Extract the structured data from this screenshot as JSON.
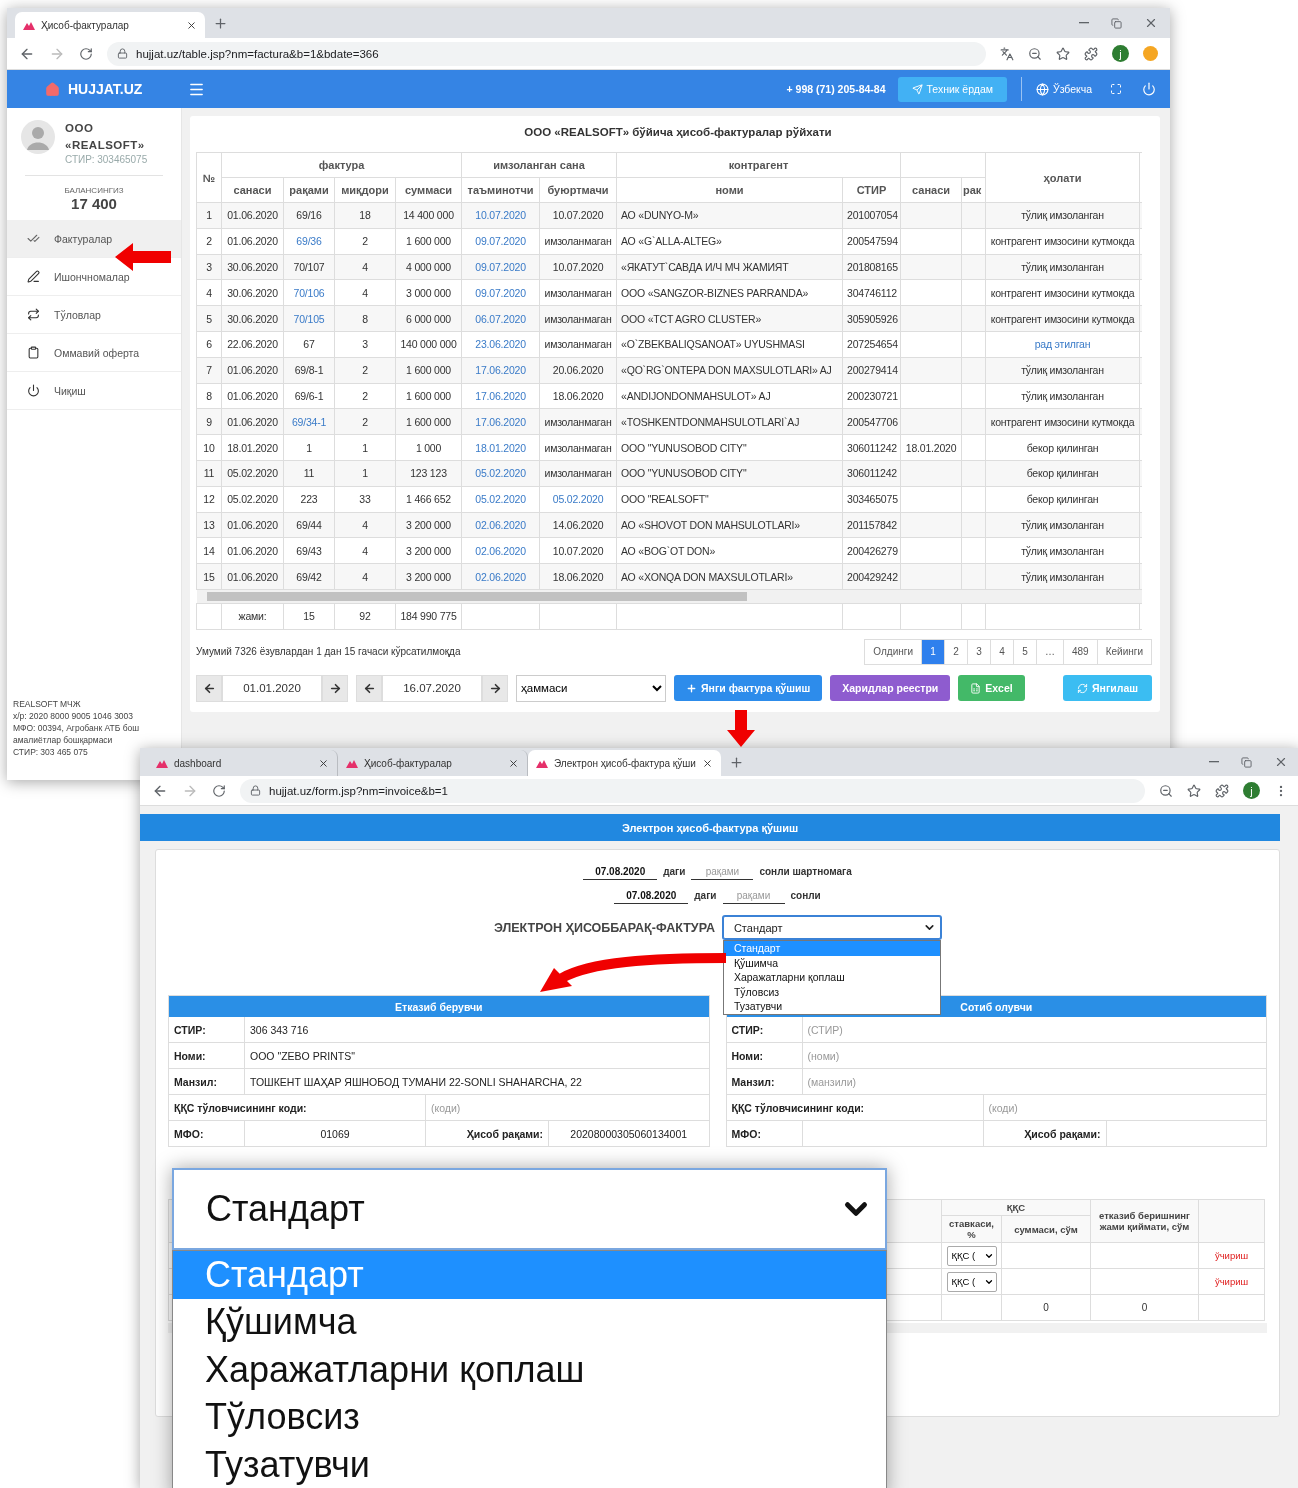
{
  "window1": {
    "tab_title": "Ҳисоб-фактуралар",
    "url": "hujjat.uz/table.jsp?nm=factura&b=1&bdate=366",
    "profile_initial": "j",
    "navbar": {
      "brand": "HUJJAT.UZ",
      "phone": "+ 998 (71) 205-84-84",
      "help_button": "Техник ёрдам",
      "language": "Ўзбекча"
    },
    "sidebar": {
      "company": "ООО «REALSOFT»",
      "stir": "СТИР: 303465075",
      "balance_label": "БАЛАНСИНГИЗ",
      "balance": "17 400",
      "items": [
        {
          "label": "Фактуралар",
          "kind": "invoices",
          "selected": true
        },
        {
          "label": "Ишончномалар",
          "kind": "proxies",
          "selected": false
        },
        {
          "label": "Тўловлар",
          "kind": "payments",
          "selected": false
        },
        {
          "label": "Оммавий оферта",
          "kind": "offer",
          "selected": false
        },
        {
          "label": "Чиқиш",
          "kind": "logout",
          "selected": false
        }
      ],
      "footer": [
        "REALSOFT МЧЖ",
        "х/р: 2020 8000 9005 1046 3003",
        "МФО: 00394, Агробанк АТБ бош амалиётлар бошқармаси",
        "СТИР: 303 465 075"
      ]
    },
    "table": {
      "title": "ООО «REALSOFT» бўйича ҳисоб-фактуралар рўйхати",
      "group_headers": [
        "фактура",
        "имзоланган сана",
        "контрагент"
      ],
      "columns": [
        "№",
        "санаси",
        "рақами",
        "миқдори",
        "суммаси",
        "таъминотчи",
        "буюртмачи",
        "номи",
        "СТИР",
        "санаси",
        "рак",
        "ҳолати"
      ],
      "rows": [
        {
          "no": "1",
          "date": "01.06.2020",
          "number": "69/16",
          "number_link": false,
          "qty": "18",
          "sum": "14 400 000",
          "supplier_date": "10.07.2020",
          "buyer_date": "10.07.2020",
          "buyer_link": false,
          "name": "АО «DUNYO-M»",
          "stir": "201007054",
          "status": "тўлиқ имзоланган",
          "status_link": false
        },
        {
          "no": "2",
          "date": "01.06.2020",
          "number": "69/36",
          "number_link": true,
          "qty": "2",
          "sum": "1 600 000",
          "supplier_date": "09.07.2020",
          "buyer_date": "имзоланмаган",
          "buyer_link": false,
          "name": "АО «G`ALLA-ALTEG»",
          "stir": "200547594",
          "status": "контрагент имзосини кутмокда",
          "status_link": false
        },
        {
          "no": "3",
          "date": "30.06.2020",
          "number": "70/107",
          "number_link": false,
          "qty": "4",
          "sum": "4 000 000",
          "supplier_date": "09.07.2020",
          "buyer_date": "10.07.2020",
          "buyer_link": false,
          "name": "«ЯКАТУТ`САВДА И/Ч МЧ ЖАМИЯТ",
          "stir": "201808165",
          "status": "тўлиқ имзоланган",
          "status_link": false
        },
        {
          "no": "4",
          "date": "30.06.2020",
          "number": "70/106",
          "number_link": true,
          "qty": "4",
          "sum": "3 000 000",
          "supplier_date": "09.07.2020",
          "buyer_date": "имзоланмаган",
          "buyer_link": false,
          "name": "ООО «SANGZOR-BIZNES PARRANDA»",
          "stir": "304746112",
          "status": "контрагент имзосини кутмокда",
          "status_link": false
        },
        {
          "no": "5",
          "date": "30.06.2020",
          "number": "70/105",
          "number_link": true,
          "qty": "8",
          "sum": "6 000 000",
          "supplier_date": "06.07.2020",
          "buyer_date": "имзоланмаган",
          "buyer_link": false,
          "name": "ООО «TCT AGRO CLUSTER»",
          "stir": "305905926",
          "status": "контрагент имзосини кутмокда",
          "status_link": false
        },
        {
          "no": "6",
          "date": "22.06.2020",
          "number": "67",
          "number_link": false,
          "qty": "3",
          "sum": "140 000 000",
          "supplier_date": "23.06.2020",
          "buyer_date": "имзоланмаган",
          "buyer_link": false,
          "name": "«O`ZBEKBALIQSANOAT» UYUSHMASI",
          "stir": "207254654",
          "status": "рад этилган",
          "status_link": true
        },
        {
          "no": "7",
          "date": "01.06.2020",
          "number": "69/8-1",
          "number_link": false,
          "qty": "2",
          "sum": "1 600 000",
          "supplier_date": "17.06.2020",
          "buyer_date": "20.06.2020",
          "buyer_link": false,
          "name": "«QO`RG`ONTEPA DON MAXSULOTLARI» AJ",
          "stir": "200279414",
          "status": "тўлиқ имзоланган",
          "status_link": false
        },
        {
          "no": "8",
          "date": "01.06.2020",
          "number": "69/6-1",
          "number_link": false,
          "qty": "2",
          "sum": "1 600 000",
          "supplier_date": "17.06.2020",
          "buyer_date": "18.06.2020",
          "buyer_link": false,
          "name": "«ANDIJONDONMAHSULOT» AJ",
          "stir": "200230721",
          "status": "тўлиқ имзоланган",
          "status_link": false
        },
        {
          "no": "9",
          "date": "01.06.2020",
          "number": "69/34-1",
          "number_link": true,
          "qty": "2",
          "sum": "1 600 000",
          "supplier_date": "17.06.2020",
          "buyer_date": "имзоланмаган",
          "buyer_link": false,
          "name": "«TOSHKENTDONMAHSULOTLARI`AJ",
          "stir": "200547706",
          "status": "контрагент имзосини кутмокда",
          "status_link": false
        },
        {
          "no": "10",
          "date": "18.01.2020",
          "number": "1",
          "number_link": false,
          "qty": "1",
          "sum": "1 000",
          "supplier_date": "18.01.2020",
          "buyer_date": "имзоланмаган",
          "buyer_link": false,
          "name": "ООО \"YUNUSOBOD CITY\"",
          "stir": "306011242",
          "cp_date": "18.01.2020",
          "status": "бекор қилинган",
          "status_link": false
        },
        {
          "no": "11",
          "date": "05.02.2020",
          "number": "11",
          "number_link": false,
          "qty": "1",
          "sum": "123 123",
          "supplier_date": "05.02.2020",
          "buyer_date": "имзоланмаган",
          "buyer_link": false,
          "name": "ООО \"YUNUSOBOD CITY\"",
          "stir": "306011242",
          "status": "бекор қилинган",
          "status_link": false
        },
        {
          "no": "12",
          "date": "05.02.2020",
          "number": "223",
          "number_link": false,
          "qty": "33",
          "sum": "1 466 652",
          "supplier_date": "05.02.2020",
          "buyer_date": "05.02.2020",
          "buyer_link": true,
          "name": "ООО \"REALSOFT\"",
          "stir": "303465075",
          "status": "бекор қилинган",
          "status_link": false
        },
        {
          "no": "13",
          "date": "01.06.2020",
          "number": "69/44",
          "number_link": false,
          "qty": "4",
          "sum": "3 200 000",
          "supplier_date": "02.06.2020",
          "buyer_date": "14.06.2020",
          "buyer_link": false,
          "name": "АО «SHOVOT DON MAHSULOTLARI»",
          "stir": "201157842",
          "status": "тўлиқ имзоланган",
          "status_link": false
        },
        {
          "no": "14",
          "date": "01.06.2020",
          "number": "69/43",
          "number_link": false,
          "qty": "4",
          "sum": "3 200 000",
          "supplier_date": "02.06.2020",
          "buyer_date": "10.07.2020",
          "buyer_link": false,
          "name": "АО «BOG`OT DON»",
          "stir": "200426279",
          "status": "тўлиқ имзоланган",
          "status_link": false
        },
        {
          "no": "15",
          "date": "01.06.2020",
          "number": "69/42",
          "number_link": false,
          "qty": "4",
          "sum": "3 200 000",
          "supplier_date": "02.06.2020",
          "buyer_date": "18.06.2020",
          "buyer_link": false,
          "name": "АО «XONQA DON MAXSULOTLARI»",
          "stir": "200429242",
          "status": "тўлиқ имзоланган",
          "status_link": false
        }
      ],
      "totals": {
        "label": "жами:",
        "count": "15",
        "quantity": "92",
        "sum": "184 990 775"
      }
    },
    "summary": "Умумий 7326 ёзувлардан 1 дан 15 гачаси кўрсатилмоқда",
    "pagination": [
      {
        "label": "Олдинги",
        "selected": false
      },
      {
        "label": "1",
        "selected": true
      },
      {
        "label": "2",
        "selected": false
      },
      {
        "label": "3",
        "selected": false
      },
      {
        "label": "4",
        "selected": false
      },
      {
        "label": "5",
        "selected": false
      },
      {
        "label": "…",
        "selected": false
      },
      {
        "label": "489",
        "selected": false
      },
      {
        "label": "Кейинги",
        "selected": false
      }
    ],
    "filters": {
      "date_from": "01.01.2020",
      "date_to": "16.07.2020",
      "status": "ҳаммаси"
    },
    "buttons": [
      {
        "label": "Янги фактура қўшиш",
        "kind": "add"
      },
      {
        "label": "Харидлар реестри",
        "kind": "registry"
      },
      {
        "label": "Excel",
        "kind": "excel"
      },
      {
        "label": "Янгилаш",
        "kind": "refresh"
      }
    ]
  },
  "window2": {
    "tabs": [
      {
        "title": "dashboard",
        "selected": false
      },
      {
        "title": "Ҳисоб-фактуралар",
        "selected": false
      },
      {
        "title": "Электрон ҳисоб-фактура қўши",
        "selected": true
      }
    ],
    "url": "hujjat.uz/form.jsp?nm=invoice&b=1",
    "profile_initial": "j",
    "header": "Электрон ҳисоб-фактура қўшиш",
    "contract": {
      "date": "07.08.2020",
      "date_suffix": "даги",
      "number_placeholder": "рақами",
      "suffix": "сонли шартномага"
    },
    "invoice": {
      "date": "07.08.2020",
      "date_suffix": "даги",
      "number_placeholder": "рақами",
      "suffix": "сонли"
    },
    "type_label": "ЭЛЕКТРОН ҲИСОББАРАҚ-ФАКТУРА",
    "type_select": {
      "value": "Стандарт",
      "expanded": true,
      "options": [
        {
          "label": "Стандарт",
          "selected": true
        },
        {
          "label": "Қўшимча",
          "selected": false
        },
        {
          "label": "Харажатларни қоплаш",
          "selected": false
        },
        {
          "label": "Тўловсиз",
          "selected": false
        },
        {
          "label": "Тузатувчи",
          "selected": false
        }
      ]
    },
    "parties": [
      {
        "title": "Етказиб берувчи",
        "fields": [
          {
            "label": "СТИР:",
            "value": "306 343 716"
          },
          {
            "label": "Номи:",
            "value": "ООО \"ZEBO PRINTS\""
          },
          {
            "label": "Манзил:",
            "value": "ТОШКЕНТ ШАҲАР ЯШНОБОД ТУМАНИ 22-SONLI SHAHARCHA, 22"
          },
          {
            "label": "ҚҚС тўловчисининг коди:",
            "placeholder": "(коди)"
          },
          {
            "label": "МФО:",
            "value": "01069"
          },
          {
            "label": "Ҳисоб рақами:",
            "value": "20208000305060134001"
          }
        ]
      },
      {
        "title": "Сотиб олувчи",
        "fields": [
          {
            "label": "СТИР:",
            "placeholder": "(СТИР)"
          },
          {
            "label": "Номи:",
            "placeholder": "(номи)"
          },
          {
            "label": "Манзил:",
            "placeholder": "(манзили)"
          },
          {
            "label": "ҚҚС тўловчисининг коди:",
            "placeholder": "(коди)"
          },
          {
            "label": "МФО:"
          },
          {
            "label": "Ҳисоб рақами:"
          }
        ]
      }
    ],
    "items_table": {
      "group_header": "ҚҚС",
      "columns": [
        "ставкаси, %",
        "суммаси, сўм",
        "етказиб беришнинг жами қиймати, сўм"
      ],
      "rows": [
        {
          "vat_select": "ҚҚС (",
          "action": "ўчириш"
        },
        {
          "vat_select": "ҚҚС (",
          "action": "ўчириш"
        }
      ],
      "totals": [
        "0",
        "0"
      ]
    }
  },
  "zoom_view": {
    "value": "Стандарт",
    "options": [
      {
        "label": "Стандарт",
        "selected": true
      },
      {
        "label": "Қўшимча",
        "selected": false
      },
      {
        "label": "Харажатларни қоплаш",
        "selected": false
      },
      {
        "label": "Тўловсиз",
        "selected": false
      },
      {
        "label": "Тузатувчи",
        "selected": false
      }
    ]
  }
}
